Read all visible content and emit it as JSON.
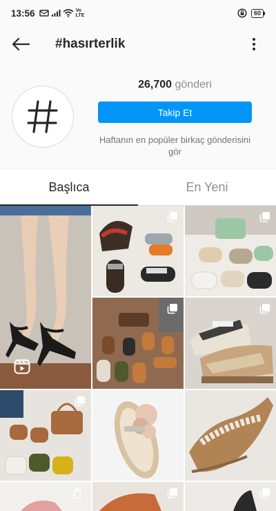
{
  "status_bar": {
    "time": "13:56",
    "volte": "Vo LTE",
    "battery": "60"
  },
  "header": {
    "title": "#hasırterlik"
  },
  "profile": {
    "avatar_glyph": "#",
    "posts_count": "26,700",
    "posts_label": "gönderi",
    "follow_button": "Takip Et",
    "hint": "Haftanın en popüler birkaç gönderisini gör"
  },
  "tabs": [
    {
      "label": "Başlıca",
      "active": true
    },
    {
      "label": "En Yeni",
      "active": false
    }
  ],
  "colors": {
    "accent": "#0095f6",
    "text": "#262626",
    "muted": "#8e8e8e"
  },
  "grid": {
    "icons": [
      "multiple-posts-icon",
      "reel-icon",
      "shopping-bag-icon"
    ]
  }
}
